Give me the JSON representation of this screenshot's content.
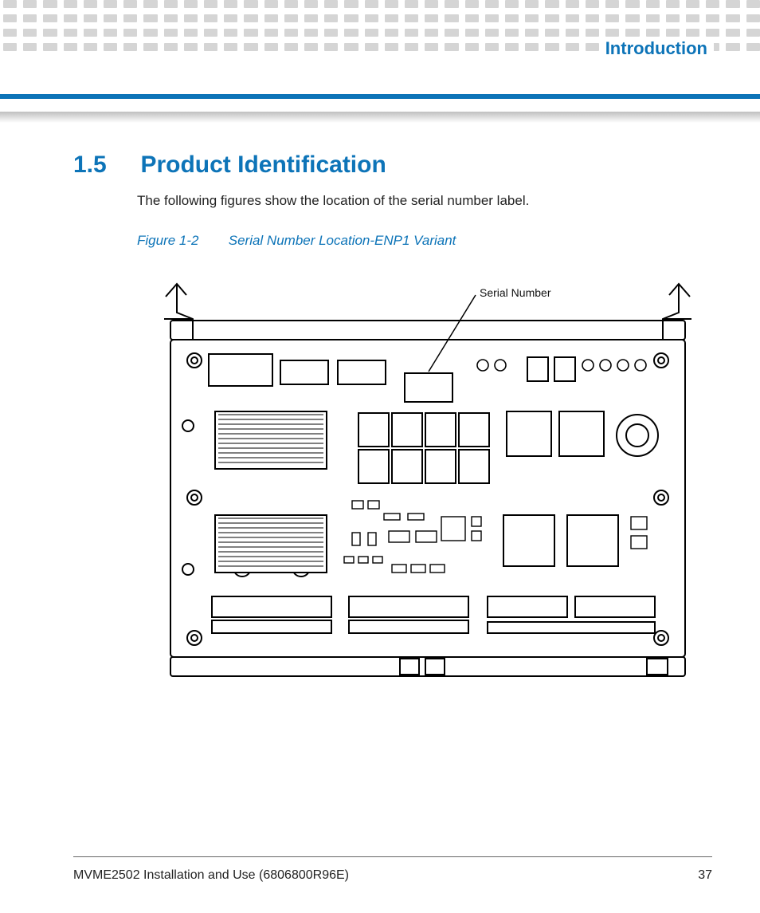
{
  "header": {
    "chapter": "Introduction"
  },
  "section": {
    "number": "1.5",
    "title": "Product Identification",
    "intro": "The following figures show the location of the serial number label."
  },
  "figure": {
    "label": "Figure 1-2",
    "caption": "Serial Number Location-ENP1 Variant",
    "callout": "Serial Number"
  },
  "footer": {
    "doc": "MVME2502 Installation and Use (6806800R96E)",
    "page": "37"
  }
}
